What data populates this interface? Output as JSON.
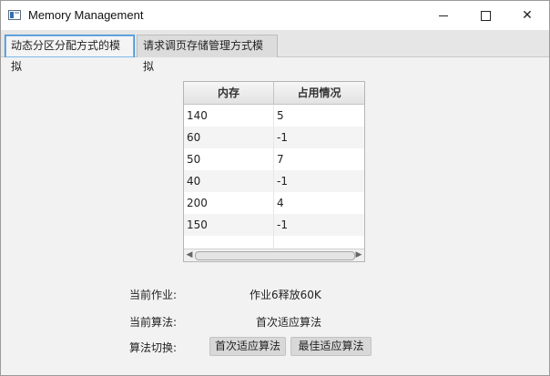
{
  "window": {
    "title": "Memory Management",
    "controls": {
      "minimize": "minimize",
      "maximize": "maximize",
      "close": "✕"
    }
  },
  "tabs": [
    {
      "label": "动态分区分配方式的模拟",
      "active": true
    },
    {
      "label": "请求调页存储管理方式模拟",
      "active": false
    }
  ],
  "table": {
    "headers": [
      "内存",
      "占用情况"
    ],
    "rows": [
      [
        "140",
        "5"
      ],
      [
        "60",
        "-1"
      ],
      [
        "50",
        "7"
      ],
      [
        "40",
        "-1"
      ],
      [
        "200",
        "4"
      ],
      [
        "150",
        "-1"
      ]
    ]
  },
  "info": {
    "current_job_label": "当前作业:",
    "current_job_value": "作业6释放60K",
    "current_algo_label": "当前算法:",
    "current_algo_value": "首次适应算法",
    "switch_label": "算法切换:"
  },
  "buttons": {
    "first_fit": "首次适应算法",
    "best_fit": "最佳适应算法"
  },
  "colors": {
    "active_tab_border": "#3d8fd6",
    "background": "#f2f2f2"
  }
}
